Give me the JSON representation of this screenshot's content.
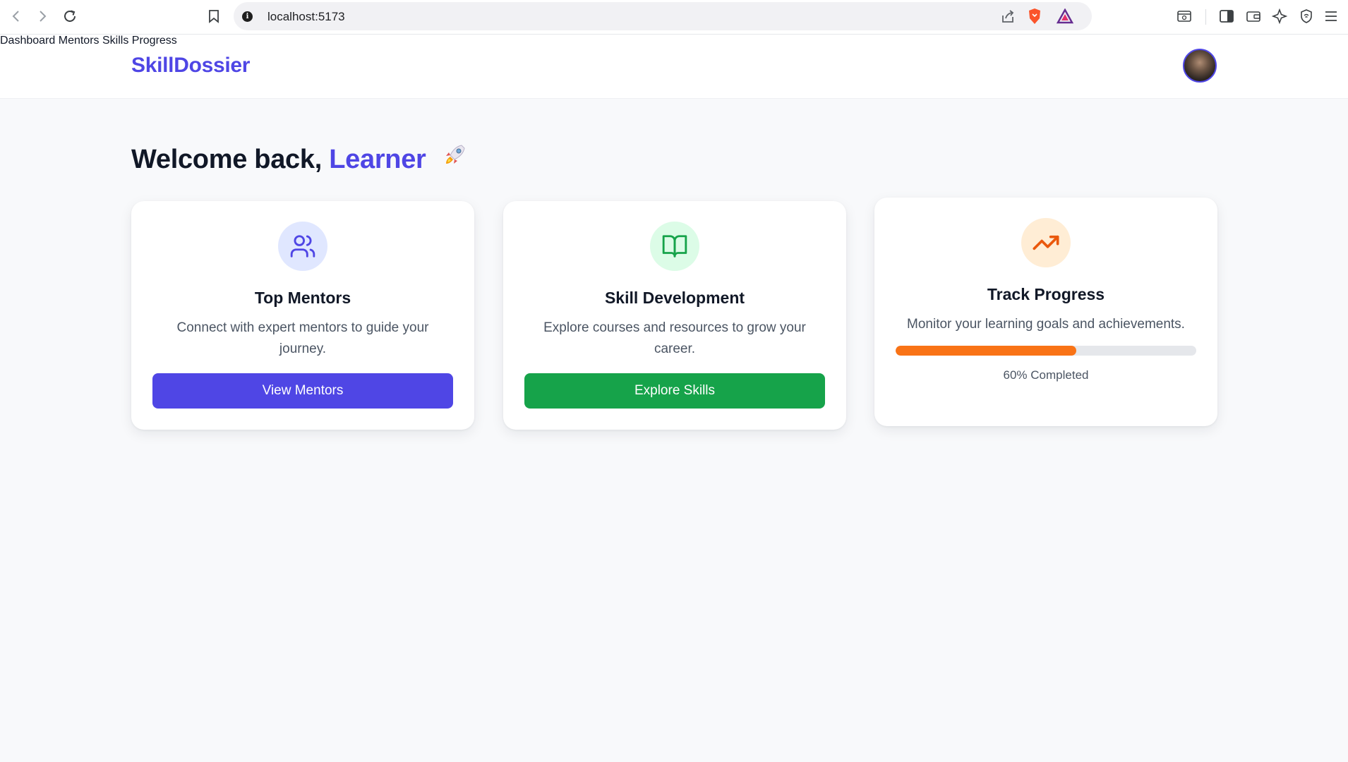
{
  "browser": {
    "url": "localhost:5173"
  },
  "header": {
    "brand": "SkillDossier",
    "nav": [
      "Dashboard",
      "Mentors",
      "Skills",
      "Progress"
    ]
  },
  "welcome": {
    "prefix": "Welcome back,",
    "name": "Learner",
    "emoji": "🚀"
  },
  "cards": [
    {
      "icon": "users-icon",
      "title": "Top Mentors",
      "description": "Connect with expert mentors to guide your journey.",
      "button": "View Mentors",
      "accent": "#4f46e5",
      "icon_bg": "#e0e7ff"
    },
    {
      "icon": "book-open-icon",
      "title": "Skill Development",
      "description": "Explore courses and resources to grow your career.",
      "button": "Explore Skills",
      "accent": "#16a34a",
      "icon_bg": "#dcfce7"
    },
    {
      "icon": "trending-up-icon",
      "title": "Track Progress",
      "description": "Monitor your learning goals and achievements.",
      "progress": 0.6,
      "progress_label": "60% Completed",
      "accent": "#f97316",
      "icon_bg": "#ffedd5"
    }
  ]
}
